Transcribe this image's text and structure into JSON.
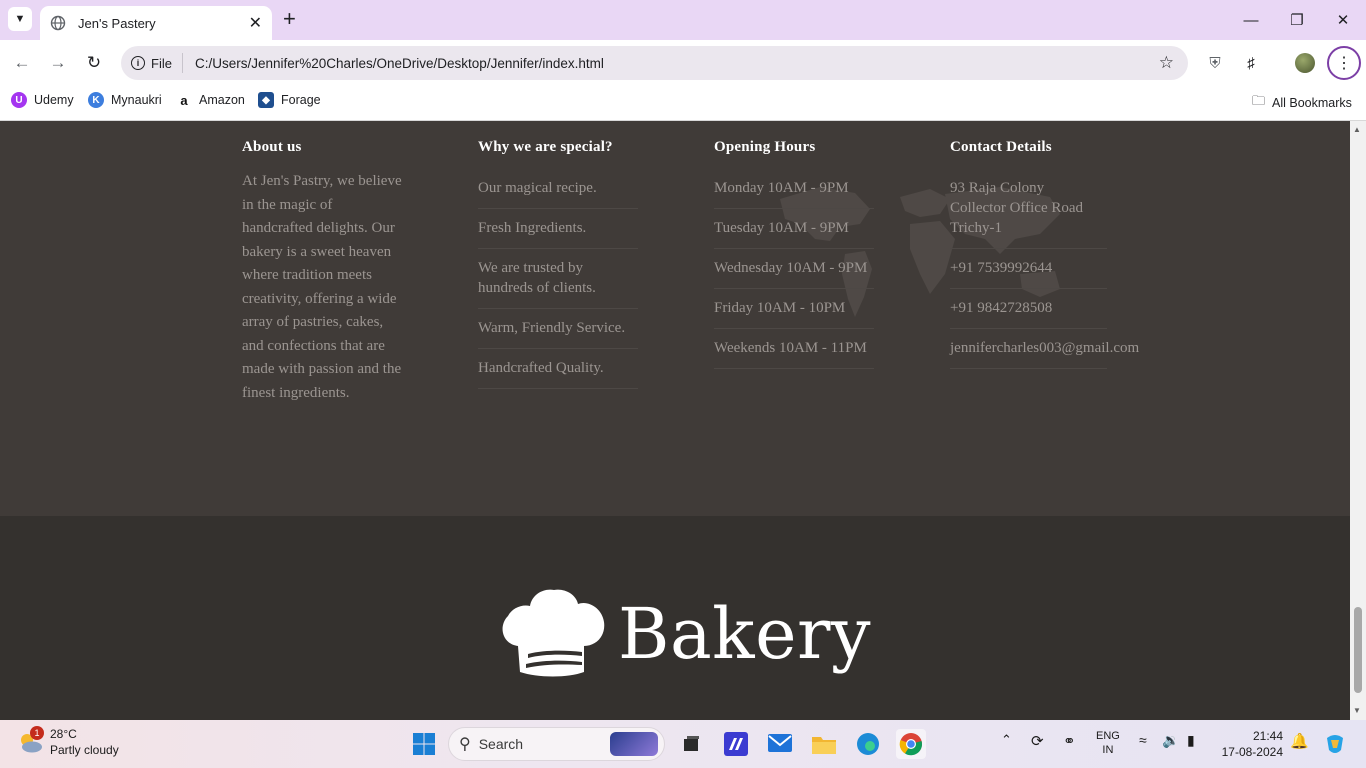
{
  "browser": {
    "tab_title": "Jen's Pastery",
    "file_chip": "File",
    "url": "C:/Users/Jennifer%20Charles/OneDrive/Desktop/Jennifer/index.html",
    "bookmarks": [
      {
        "label": "Udemy",
        "icon": "udemy-icon"
      },
      {
        "label": "Mynaukri",
        "icon": "mynaukri-icon"
      },
      {
        "label": "Amazon",
        "icon": "amazon-icon"
      },
      {
        "label": "Forage",
        "icon": "forage-icon"
      }
    ],
    "all_bookmarks": "All Bookmarks"
  },
  "footer": {
    "about": {
      "heading": "About us",
      "text": "At Jen's Pastry, we believe in the magic of handcrafted delights. Our bakery is a sweet heaven where tradition meets creativity, offering a wide array of pastries, cakes, and confections that are made with passion and the finest ingredients."
    },
    "special": {
      "heading": "Why we are special?",
      "items": [
        "Our magical recipe.",
        "Fresh Ingredients.",
        "We are trusted by hundreds of clients.",
        "Warm, Friendly Service.",
        "Handcrafted Quality."
      ]
    },
    "hours": {
      "heading": "Opening Hours",
      "items": [
        "Monday 10AM - 9PM",
        "Tuesday 10AM - 9PM",
        "Wednesday 10AM - 9PM",
        "Friday 10AM - 10PM",
        "Weekends 10AM - 11PM"
      ]
    },
    "contact": {
      "heading": "Contact Details",
      "address_lines": [
        "93 Raja Colony",
        "Collector Office Road",
        "Trichy-1"
      ],
      "phone1": "+91 7539992644",
      "phone2": "+91 9842728508",
      "email": "jennifercharles003@gmail.com"
    },
    "logo_text": "Bakery"
  },
  "taskbar": {
    "weather_badge": "1",
    "temperature": "28°C",
    "condition": "Partly cloudy",
    "search_placeholder": "Search",
    "lang_top": "ENG",
    "lang_bottom": "IN",
    "time": "21:44",
    "date": "17-08-2024"
  },
  "colors": {
    "footer_top_bg": "#403b38",
    "footer_bottom_bg": "#34312e",
    "tabstrip_bg": "#e9d7f5",
    "heading_text": "#ffffff",
    "body_text": "#9b9591"
  }
}
